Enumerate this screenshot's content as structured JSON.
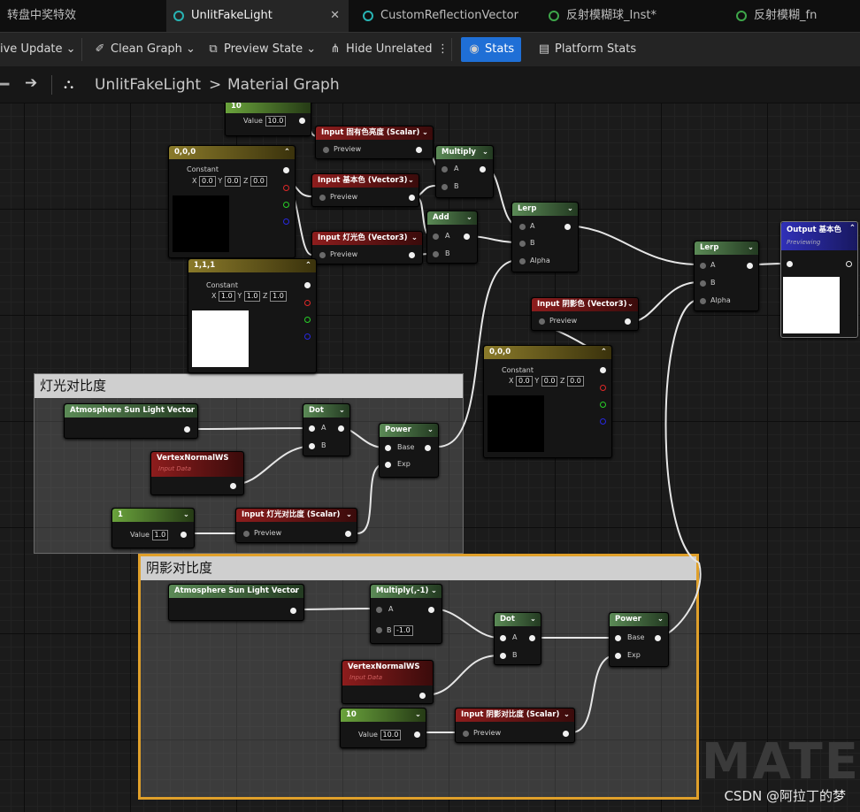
{
  "tabs": [
    {
      "label": "转盘中奖特效",
      "active": false,
      "icon": ""
    },
    {
      "label": "UnlitFakeLight",
      "active": true,
      "icon": "material-icon"
    },
    {
      "label": "CustomReflectionVector",
      "active": false,
      "icon": "material-function-icon"
    },
    {
      "label": "反射模糊球_Inst*",
      "active": false,
      "icon": "material-instance-icon"
    },
    {
      "label": "反射模糊_fn",
      "active": false,
      "icon": "material-function-icon"
    }
  ],
  "toolbar": {
    "live_update": "ive Update",
    "clean_graph": "Clean Graph",
    "preview_state": "Preview State",
    "hide_unrelated": "Hide Unrelated",
    "stats": "Stats",
    "platform_stats": "Platform Stats"
  },
  "breadcrumb": {
    "root": "UnlitFakeLight",
    "sep": ">",
    "current": "Material Graph"
  },
  "comments": {
    "light": "灯光对比度",
    "shadow": "阴影对比度"
  },
  "nodes": {
    "c10": {
      "title": "10",
      "value_label": "Value",
      "value": "10.0"
    },
    "in_inherent": {
      "title": "Input 固有色亮度 (Scalar)",
      "preview": "Preview"
    },
    "multiply": {
      "title": "Multiply",
      "a": "A",
      "b": "B"
    },
    "const000a": {
      "title": "0,0,0",
      "label": "Constant",
      "x": "0.0",
      "y": "0.0",
      "z": "0.0",
      "xl": "X",
      "yl": "Y",
      "zl": "Z"
    },
    "in_base": {
      "title": "Input 基本色 (Vector3)",
      "preview": "Preview"
    },
    "add": {
      "title": "Add",
      "a": "A",
      "b": "B"
    },
    "in_light": {
      "title": "Input 灯光色 (Vector3)",
      "preview": "Preview"
    },
    "lerp1": {
      "title": "Lerp",
      "a": "A",
      "b": "B",
      "alpha": "Alpha"
    },
    "const111": {
      "title": "1,1,1",
      "label": "Constant",
      "x": "1.0",
      "y": "1.0",
      "z": "1.0",
      "xl": "X",
      "yl": "Y",
      "zl": "Z"
    },
    "lerp2": {
      "title": "Lerp",
      "a": "A",
      "b": "B",
      "alpha": "Alpha"
    },
    "output": {
      "title": "Output 基本色",
      "sub": "Previewing"
    },
    "in_shadow": {
      "title": "Input 阴影色 (Vector3)",
      "preview": "Preview"
    },
    "const000b": {
      "title": "0,0,0",
      "label": "Constant",
      "x": "0.0",
      "y": "0.0",
      "z": "0.0",
      "xl": "X",
      "yl": "Y",
      "zl": "Z"
    },
    "sun1": {
      "title": "Atmosphere Sun Light Vector"
    },
    "dot1": {
      "title": "Dot",
      "a": "A",
      "b": "B"
    },
    "power1": {
      "title": "Power",
      "base": "Base",
      "exp": "Exp"
    },
    "vnormal1": {
      "title": "VertexNormalWS",
      "sub": "Input Data"
    },
    "c1": {
      "title": "1",
      "value_label": "Value",
      "value": "1.0"
    },
    "in_lightcontrast": {
      "title": "Input 灯光对比度 (Scalar)",
      "preview": "Preview"
    },
    "sun2": {
      "title": "Atmosphere Sun Light Vector"
    },
    "mulneg": {
      "title": "Multiply(,-1)",
      "a": "A",
      "b": "B",
      "bval": "-1.0"
    },
    "dot2": {
      "title": "Dot",
      "a": "A",
      "b": "B"
    },
    "power2": {
      "title": "Power",
      "base": "Base",
      "exp": "Exp"
    },
    "vnormal2": {
      "title": "VertexNormalWS",
      "sub": "Input Data"
    },
    "c10b": {
      "title": "10",
      "value_label": "Value",
      "value": "10.0"
    },
    "in_shadowcontrast": {
      "title": "Input 阴影对比度 (Scalar)",
      "preview": "Preview"
    }
  },
  "watermark": "MATE",
  "credit": "CSDN @阿拉丁的梦"
}
